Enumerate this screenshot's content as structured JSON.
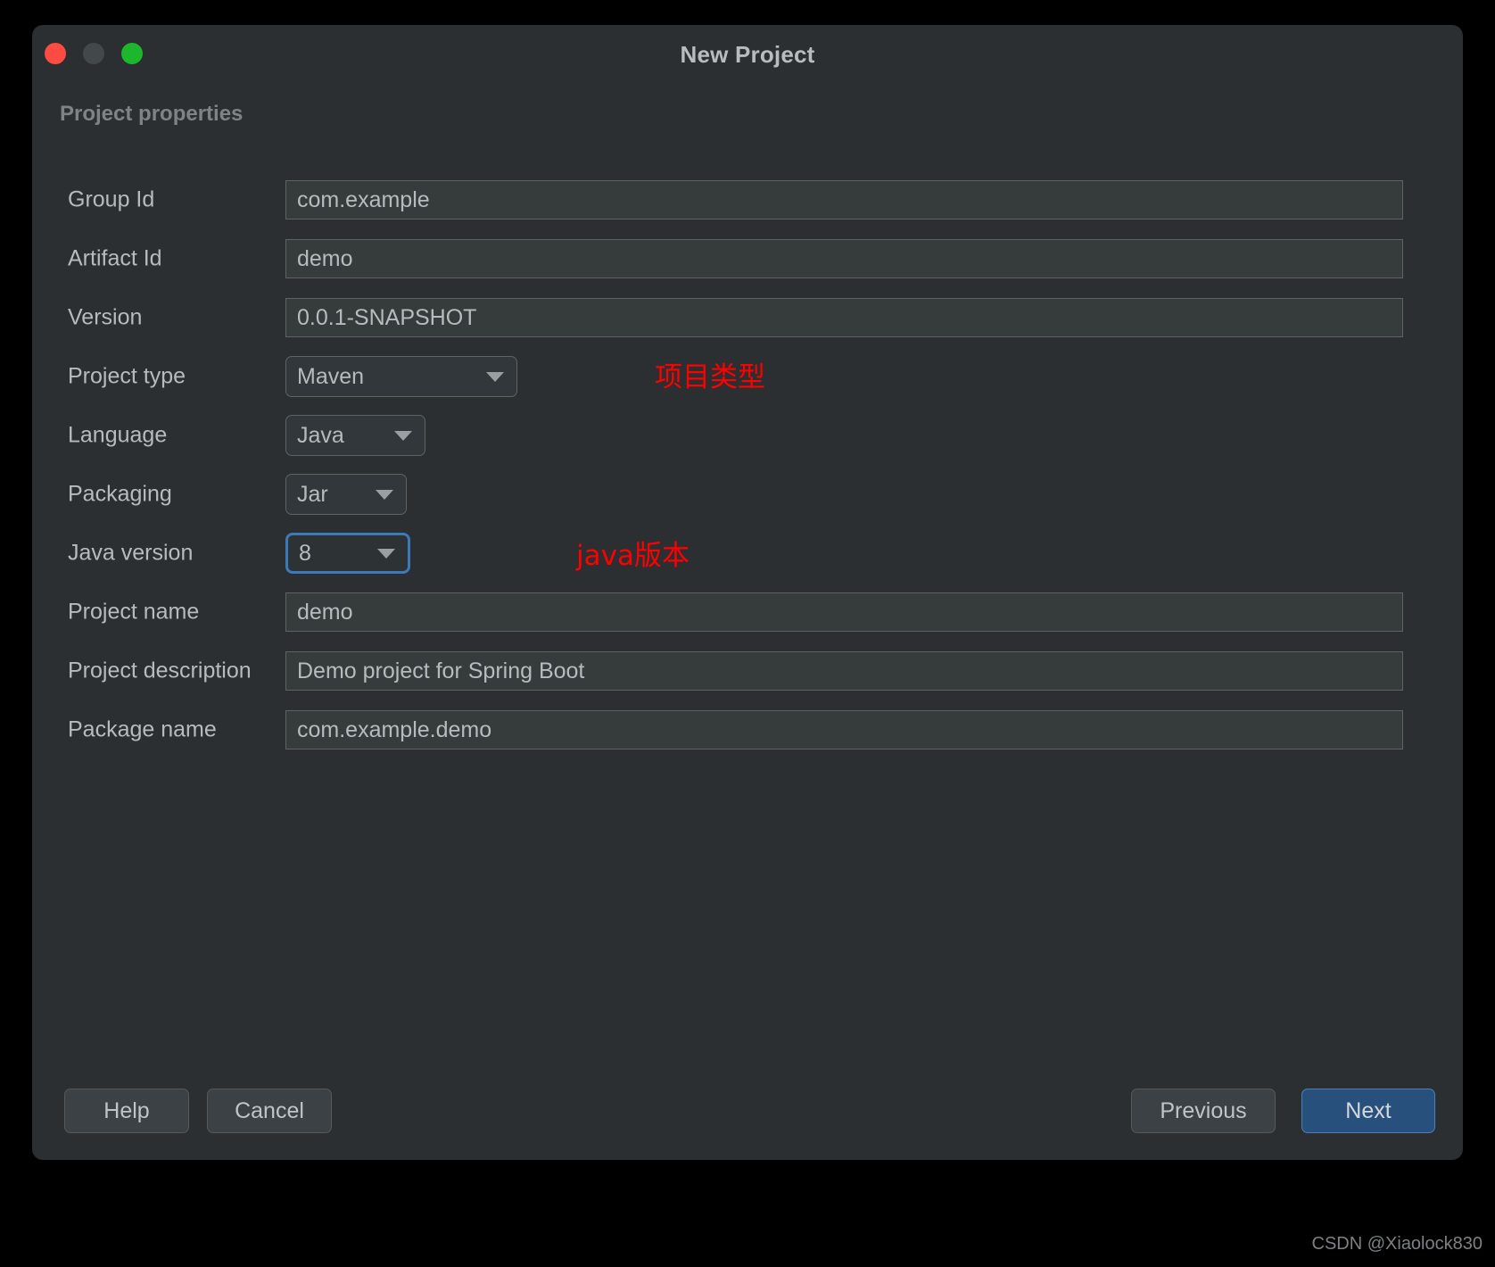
{
  "window": {
    "title": "New Project",
    "traffic_lights": [
      {
        "name": "close",
        "color": "#fc4c41"
      },
      {
        "name": "minimize",
        "color": "#43484b"
      },
      {
        "name": "zoom",
        "color": "#1cb72c"
      }
    ]
  },
  "section": {
    "heading": "Project properties"
  },
  "fields": [
    {
      "label": "Group Id",
      "control": "text",
      "value": "com.example"
    },
    {
      "label": "Artifact Id",
      "control": "text",
      "value": "demo"
    },
    {
      "label": "Version",
      "control": "text",
      "value": "0.0.1-SNAPSHOT"
    },
    {
      "label": "Project type",
      "control": "dropdown",
      "value": "Maven",
      "focused": false
    },
    {
      "label": "Language",
      "control": "dropdown",
      "value": "Java",
      "focused": false
    },
    {
      "label": "Packaging",
      "control": "dropdown",
      "value": "Jar",
      "focused": false
    },
    {
      "label": "Java version",
      "control": "dropdown",
      "value": "8",
      "focused": true
    },
    {
      "label": "Project name",
      "control": "text",
      "value": "demo"
    },
    {
      "label": "Project description",
      "control": "text",
      "value": "Demo project for Spring Boot"
    },
    {
      "label": "Package name",
      "control": "text",
      "value": "com.example.demo"
    }
  ],
  "annotations": [
    {
      "text": "项目类型",
      "target": "Project type",
      "color": "#fe0000"
    },
    {
      "text": "java版本",
      "target": "Java version",
      "color": "#fe0000"
    }
  ],
  "buttons": {
    "help": "Help",
    "cancel": "Cancel",
    "previous": "Previous",
    "next": "Next"
  },
  "watermark": "CSDN @Xiaolock830"
}
